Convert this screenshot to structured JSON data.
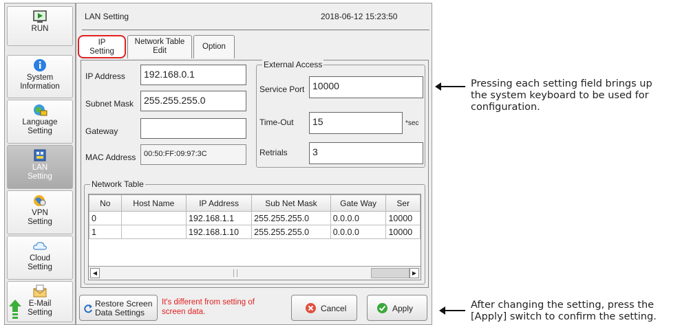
{
  "sidebar": {
    "items": [
      {
        "label": "RUN",
        "icon": "run-icon"
      },
      {
        "label": "System Information",
        "icon": "info-icon"
      },
      {
        "label": "Language Setting",
        "icon": "language-icon"
      },
      {
        "label": "LAN Setting",
        "icon": "lan-icon",
        "active": true
      },
      {
        "label": "VPN Setting",
        "icon": "vpn-icon"
      },
      {
        "label": "Cloud Setting",
        "icon": "cloud-icon"
      },
      {
        "label": "E-Mail Setting",
        "icon": "email-icon"
      }
    ]
  },
  "header": {
    "title": "LAN Setting",
    "datetime": "2018-06-12 15:23:50"
  },
  "tabs": [
    {
      "label_line1": "IP",
      "label_line2": "Setting"
    },
    {
      "label_line1": "Network Table",
      "label_line2": "Edit"
    },
    {
      "label_line1": "Option",
      "label_line2": ""
    }
  ],
  "ip": {
    "address_label": "IP Address",
    "address_value": "192.168.0.1",
    "subnet_label": "Subnet Mask",
    "subnet_value": "255.255.255.0",
    "gateway_label": "Gateway",
    "gateway_value": "",
    "mac_label": "MAC Address",
    "mac_value": "00:50:FF:09:97:3C"
  },
  "external": {
    "title": "External Access",
    "service_port_label": "Service Port",
    "service_port_value": "10000",
    "timeout_label": "Time-Out",
    "timeout_value": "15",
    "timeout_unit": "*sec",
    "retrials_label": "Retrials",
    "retrials_value": "3"
  },
  "network_table": {
    "title": "Network Table",
    "columns": [
      "No",
      "Host Name",
      "IP Address",
      "Sub Net Mask",
      "Gate Way",
      "Ser"
    ],
    "rows": [
      [
        "0",
        "",
        "192.168.1.1",
        "255.255.255.0",
        "0.0.0.0",
        "10000"
      ],
      [
        "1",
        "",
        "192.168.1.10",
        "255.255.255.0",
        "0.0.0.0",
        "10000"
      ]
    ]
  },
  "footer": {
    "restore_line1": "Restore Screen",
    "restore_line2": "Data Settings",
    "warning_line1": "It's different from setting of",
    "warning_line2": "screen data.",
    "cancel": "Cancel",
    "apply": "Apply"
  },
  "annotations": {
    "top_line1": "Pressing each setting field brings up",
    "top_line2": "the system keyboard to be used for",
    "top_line3": "configuration.",
    "bottom_line1": "After changing the setting, press the",
    "bottom_line2": "[Apply] switch to confirm the setting."
  },
  "colors": {
    "highlight": "#e02020",
    "cancel_icon": "#e05040",
    "apply_icon": "#3aa83a"
  }
}
